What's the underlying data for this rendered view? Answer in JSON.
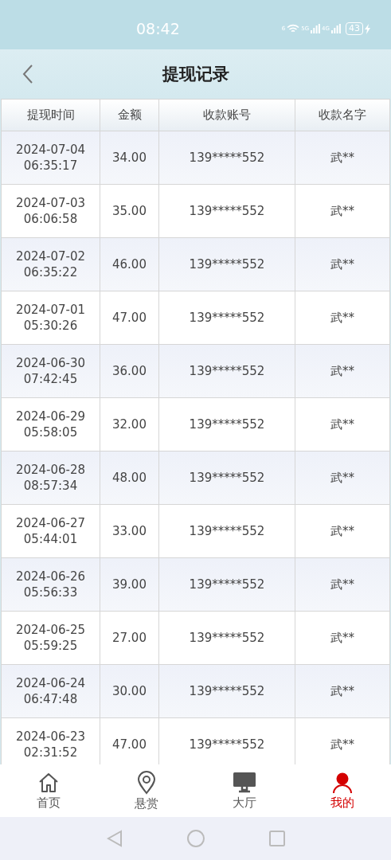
{
  "status_bar": {
    "time": "08:42",
    "wifi_label": "6",
    "signals": [
      {
        "label": "5G"
      },
      {
        "label": "4G"
      }
    ],
    "battery": "43",
    "charging": true
  },
  "header": {
    "title": "提现记录"
  },
  "table": {
    "columns": [
      "提现时间",
      "金额",
      "收款账号",
      "收款名字"
    ],
    "rows": [
      {
        "date": "2024-07-04",
        "time": "06:35:17",
        "amount": "34.00",
        "account": "139*****552",
        "name": "武**"
      },
      {
        "date": "2024-07-03",
        "time": "06:06:58",
        "amount": "35.00",
        "account": "139*****552",
        "name": "武**"
      },
      {
        "date": "2024-07-02",
        "time": "06:35:22",
        "amount": "46.00",
        "account": "139*****552",
        "name": "武**"
      },
      {
        "date": "2024-07-01",
        "time": "05:30:26",
        "amount": "47.00",
        "account": "139*****552",
        "name": "武**"
      },
      {
        "date": "2024-06-30",
        "time": "07:42:45",
        "amount": "36.00",
        "account": "139*****552",
        "name": "武**"
      },
      {
        "date": "2024-06-29",
        "time": "05:58:05",
        "amount": "32.00",
        "account": "139*****552",
        "name": "武**"
      },
      {
        "date": "2024-06-28",
        "time": "08:57:34",
        "amount": "48.00",
        "account": "139*****552",
        "name": "武**"
      },
      {
        "date": "2024-06-27",
        "time": "05:44:01",
        "amount": "33.00",
        "account": "139*****552",
        "name": "武**"
      },
      {
        "date": "2024-06-26",
        "time": "05:56:33",
        "amount": "39.00",
        "account": "139*****552",
        "name": "武**"
      },
      {
        "date": "2024-06-25",
        "time": "05:59:25",
        "amount": "27.00",
        "account": "139*****552",
        "name": "武**"
      },
      {
        "date": "2024-06-24",
        "time": "06:47:48",
        "amount": "30.00",
        "account": "139*****552",
        "name": "武**"
      },
      {
        "date": "2024-06-23",
        "time": "02:31:52",
        "amount": "47.00",
        "account": "139*****552",
        "name": "武**"
      }
    ]
  },
  "tab_bar": [
    {
      "kind": "home",
      "label": "首页",
      "selected": false
    },
    {
      "kind": "pin",
      "label": "悬赏",
      "selected": false
    },
    {
      "kind": "monitor",
      "label": "大厅",
      "selected": false
    },
    {
      "kind": "person",
      "label": "我的",
      "selected": true
    }
  ]
}
